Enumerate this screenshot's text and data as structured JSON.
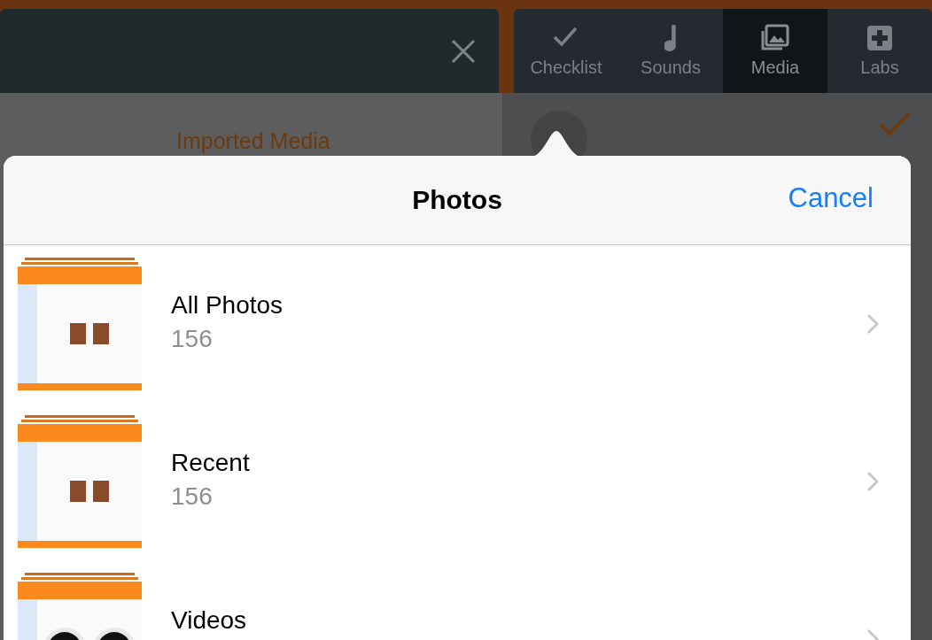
{
  "background": {
    "tabs": [
      {
        "label": "Checklist",
        "kind": "check",
        "selected": false
      },
      {
        "label": "Sounds",
        "kind": "note",
        "selected": false
      },
      {
        "label": "Media",
        "kind": "photos",
        "selected": true
      },
      {
        "label": "Labs",
        "kind": "plus",
        "selected": false
      }
    ],
    "section_title": "Imported Media"
  },
  "sheet": {
    "title": "Photos",
    "cancel": "Cancel",
    "albums": [
      {
        "title": "All Photos",
        "count": "156",
        "kind": "screens"
      },
      {
        "title": "Recent",
        "count": "156",
        "kind": "screens"
      },
      {
        "title": "Videos",
        "kind": "dials"
      }
    ]
  }
}
